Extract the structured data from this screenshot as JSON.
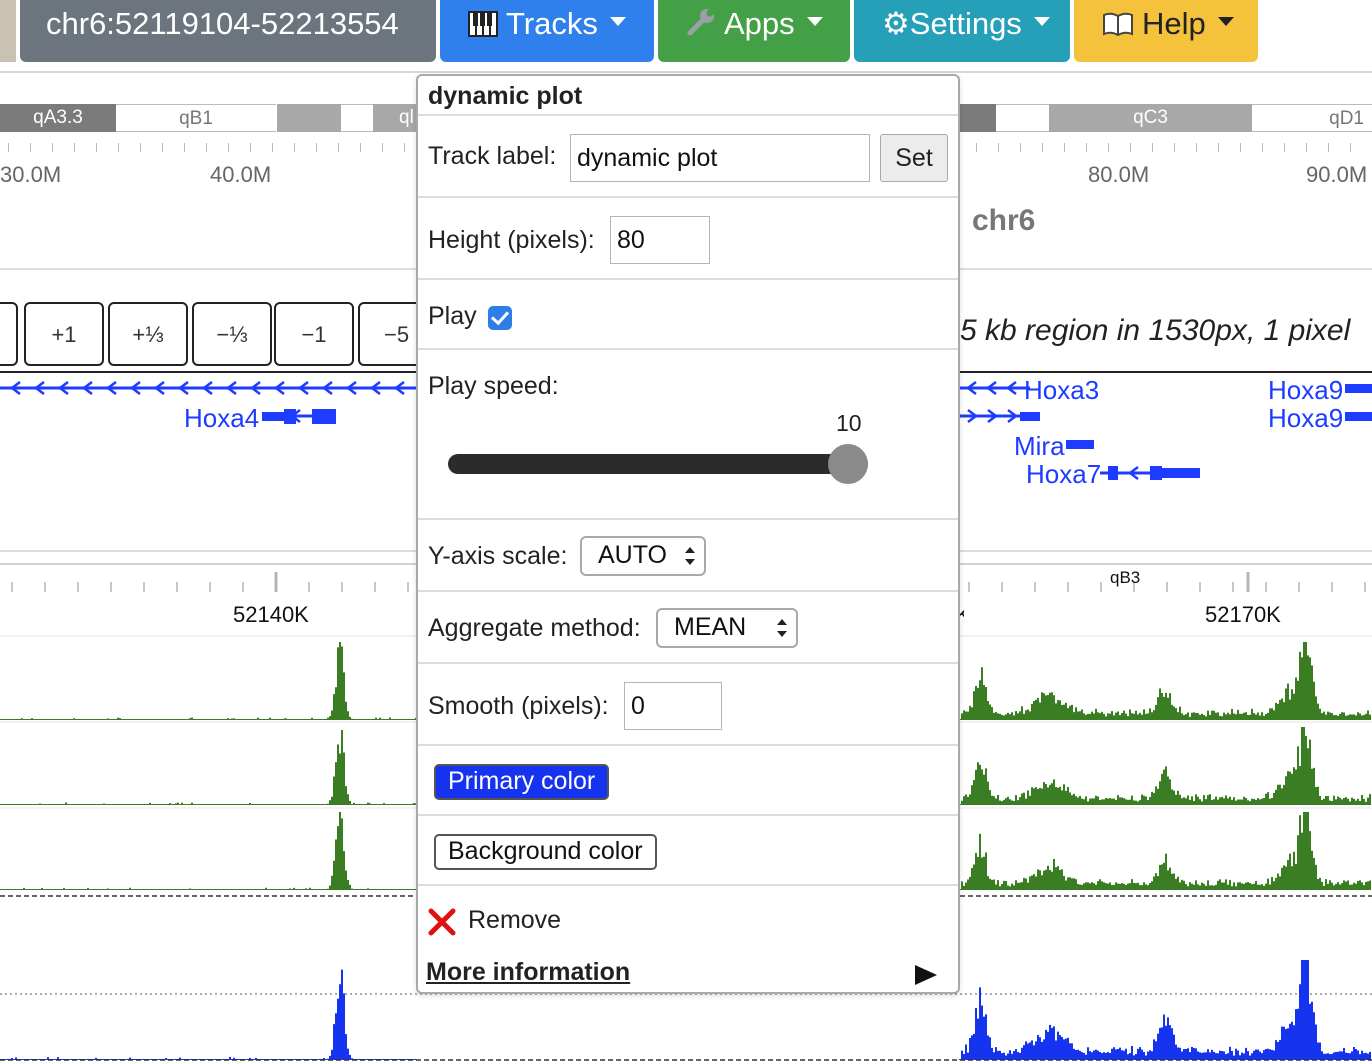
{
  "nav": {
    "locus": "chr6:52119104-52213554",
    "tracks": "Tracks",
    "apps": "Apps",
    "settings": "Settings",
    "help": "Help"
  },
  "ideogram": {
    "bands": [
      "qA3.3",
      "qB1",
      "qB3",
      "qC3",
      "qD1"
    ],
    "clipped_band": "ql",
    "ticks": [
      "30.0M",
      "40.0M",
      "80.0M",
      "90.0M"
    ],
    "chromosome": "chr6"
  },
  "zoom_buttons": [
    "+1",
    "+⅓",
    "−⅓",
    "−1",
    "−5"
  ],
  "zoom_stub": "",
  "region_text": "5 kb region in 1530px, 1 pixel",
  "genes": [
    "Hoxa4",
    "Hoxa3",
    "Hoxa9",
    "Hoxa9",
    "Mira",
    "Hoxa7"
  ],
  "positions": [
    "52140K",
    "52170K",
    "K",
    "qB3"
  ],
  "popup": {
    "title": "dynamic plot",
    "track_label_label": "Track label:",
    "track_label_value": "dynamic plot",
    "set_label": "Set",
    "height_label": "Height (pixels):",
    "height_value": "80",
    "play_label": "Play",
    "play_checked": true,
    "play_speed_label": "Play speed:",
    "play_speed_value": "10",
    "play_speed_fraction": 1.0,
    "yaxis_label": "Y-axis scale:",
    "yaxis_value": "AUTO",
    "aggregate_label": "Aggregate method:",
    "aggregate_value": "MEAN",
    "smooth_label": "Smooth (pixels):",
    "smooth_value": "0",
    "primary_color_label": "Primary color",
    "background_color_label": "Background color",
    "remove_label": "Remove",
    "more_info_label": "More information"
  },
  "colors": {
    "primary_track": "#1633f0",
    "green_track": "#3b7d23",
    "gene": "#1d3cff",
    "remove": "#e01010"
  }
}
